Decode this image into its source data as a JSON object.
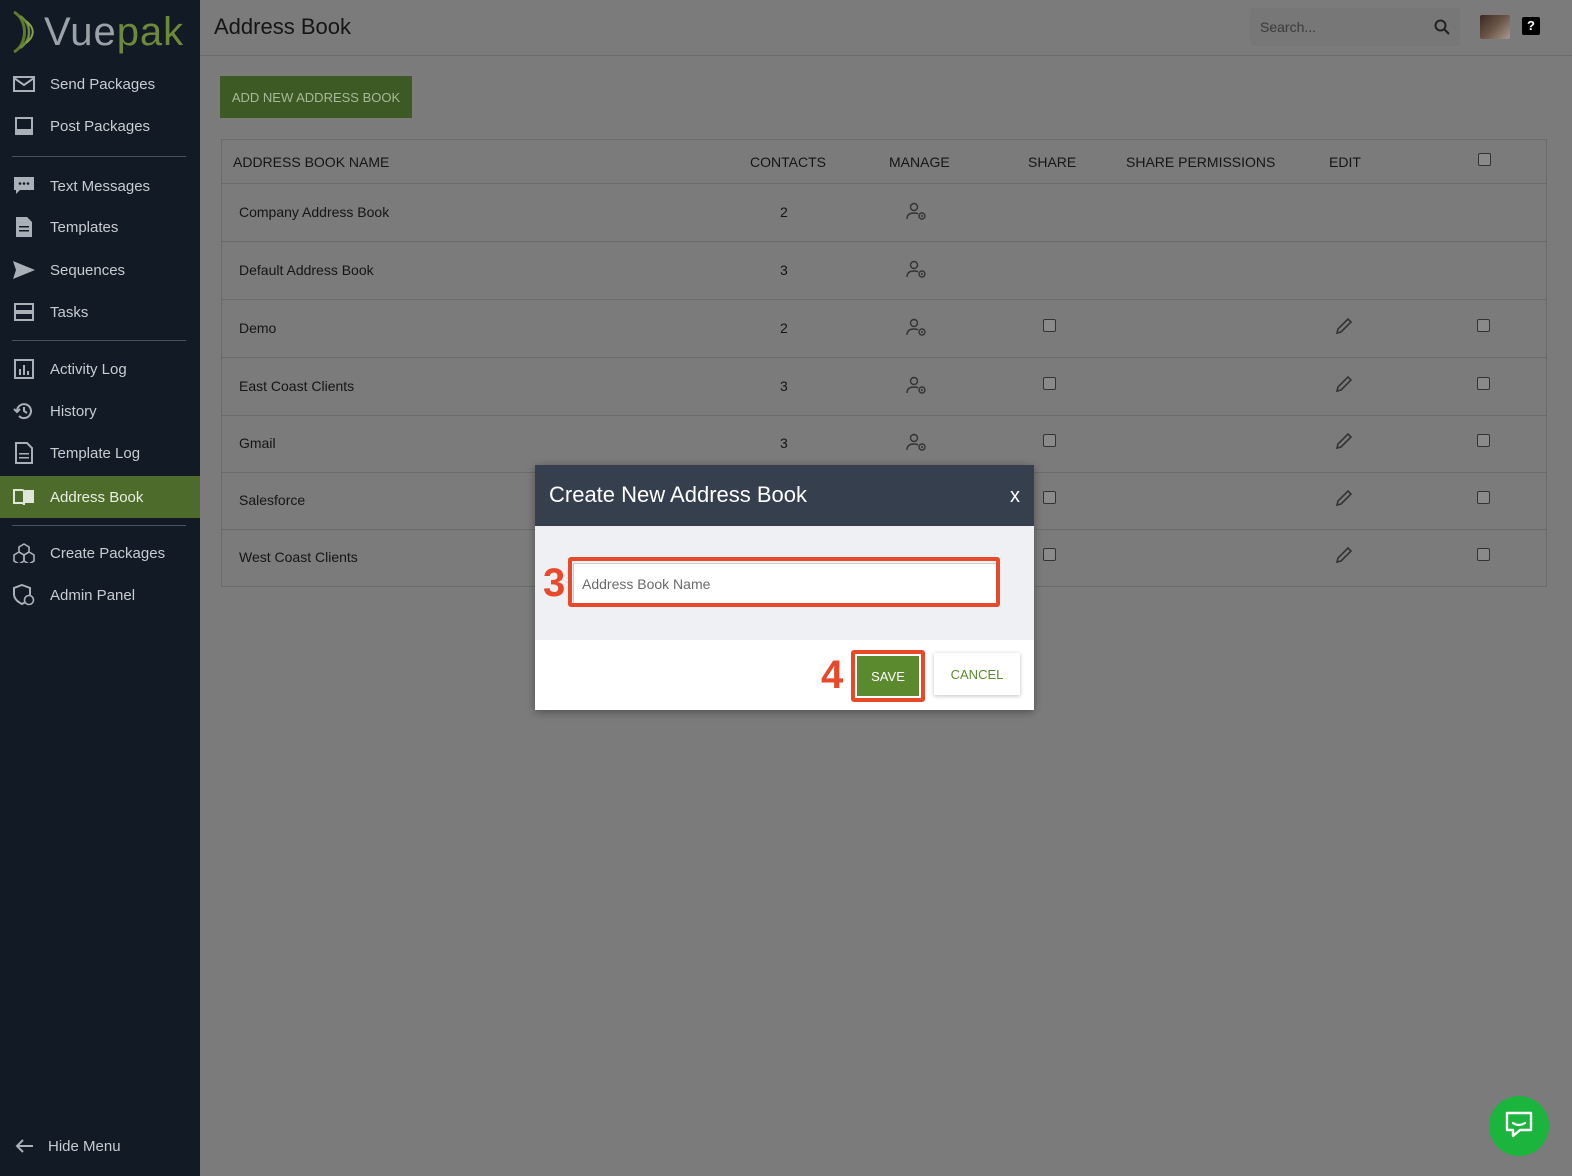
{
  "brand": {
    "name_part1": "Vue",
    "name_part2": "pak"
  },
  "sidebar": {
    "items": [
      {
        "label": "Send Packages",
        "icon": "envelope-icon"
      },
      {
        "label": "Post Packages",
        "icon": "screen-icon"
      },
      {
        "label": "Text Messages",
        "icon": "chat-bubble-icon"
      },
      {
        "label": "Templates",
        "icon": "document-icon"
      },
      {
        "label": "Sequences",
        "icon": "paper-plane-icon"
      },
      {
        "label": "Tasks",
        "icon": "server-icon"
      },
      {
        "label": "Activity Log",
        "icon": "bar-chart-icon"
      },
      {
        "label": "History",
        "icon": "history-icon"
      },
      {
        "label": "Template Log",
        "icon": "document-icon"
      },
      {
        "label": "Address Book",
        "icon": "book-icon",
        "active": true
      },
      {
        "label": "Create Packages",
        "icon": "cubes-icon"
      },
      {
        "label": "Admin Panel",
        "icon": "shield-icon"
      }
    ],
    "hide_menu": "Hide Menu"
  },
  "header": {
    "title": "Address Book",
    "search_placeholder": "Search..."
  },
  "toolbar": {
    "add_label": "ADD NEW ADDRESS BOOK"
  },
  "table": {
    "columns": [
      "ADDRESS BOOK NAME",
      "CONTACTS",
      "MANAGE",
      "SHARE",
      "SHARE PERMISSIONS",
      "EDIT"
    ],
    "rows": [
      {
        "name": "Company Address Book",
        "contacts": "2"
      },
      {
        "name": "Default Address Book",
        "contacts": "3"
      },
      {
        "name": "Demo",
        "contacts": "2"
      },
      {
        "name": "East Coast Clients",
        "contacts": "3"
      },
      {
        "name": "Gmail",
        "contacts": "3"
      },
      {
        "name": "Salesforce",
        "contacts": ""
      },
      {
        "name": "West Coast Clients",
        "contacts": ""
      }
    ]
  },
  "modal": {
    "title": "Create New Address Book",
    "close": "x",
    "input_placeholder": "Address Book Name",
    "input_value": "",
    "save": "SAVE",
    "cancel": "CANCEL",
    "step_input": "3",
    "step_save": "4"
  },
  "colors": {
    "sidebar_bg": "#121a25",
    "active_bg": "#4d6b2a",
    "highlight": "#e8492b",
    "save_bg": "#5b8a2e",
    "modal_header": "#363f4e",
    "chat_bg": "#1bb43c"
  }
}
